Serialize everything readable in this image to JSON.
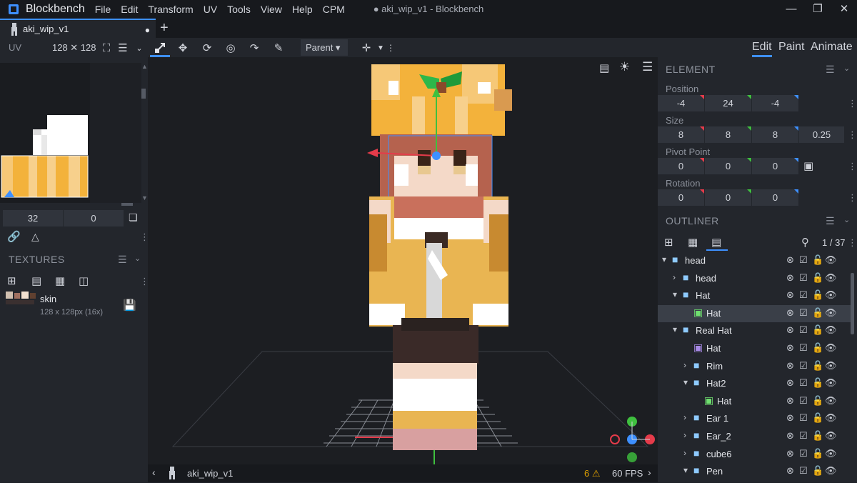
{
  "app": {
    "name": "Blockbench",
    "window_title": "● aki_wip_v1 - Blockbench",
    "menu": [
      "File",
      "Edit",
      "Transform",
      "UV",
      "Tools",
      "View",
      "Help",
      "CPM"
    ]
  },
  "tab": {
    "label": "aki_wip_v1",
    "modified": "●",
    "add": "+"
  },
  "toolbar": {
    "uv_label": "UV",
    "uv_size": "128 ✕ 128",
    "parent_label": "Parent ▾",
    "modes": [
      "Edit",
      "Paint",
      "Animate"
    ]
  },
  "uv_panel": {
    "offset_x": "32",
    "offset_y": "0"
  },
  "textures": {
    "title": "TEXTURES",
    "item": {
      "name": "skin",
      "info": "128 x 128px (16x)"
    }
  },
  "element": {
    "title": "ELEMENT",
    "position_label": "Position",
    "position": [
      "-4",
      "24",
      "-4"
    ],
    "size_label": "Size",
    "size": [
      "8",
      "8",
      "8",
      "0.25"
    ],
    "pivot_label": "Pivot Point",
    "pivot": [
      "0",
      "0",
      "0"
    ],
    "rotation_label": "Rotation",
    "rotation": [
      "0",
      "0",
      "0"
    ]
  },
  "outliner": {
    "title": "OUTLINER",
    "count": "1 / 37",
    "rows": [
      {
        "label": "head",
        "type": "folder",
        "toggle": "▾"
      },
      {
        "label": "head",
        "type": "folder",
        "toggle": "›"
      },
      {
        "label": "Hat",
        "type": "folder",
        "toggle": "▾"
      },
      {
        "label": "Hat",
        "type": "cube-green",
        "toggle": ""
      },
      {
        "label": "Real Hat",
        "type": "folder",
        "toggle": "▾"
      },
      {
        "label": "Hat",
        "type": "cube-purple",
        "toggle": ""
      },
      {
        "label": "Rim",
        "type": "folder",
        "toggle": "›"
      },
      {
        "label": "Hat2",
        "type": "folder",
        "toggle": "▾"
      },
      {
        "label": "Hat",
        "type": "cube-green",
        "toggle": ""
      },
      {
        "label": "Ear 1",
        "type": "folder",
        "toggle": "›"
      },
      {
        "label": "Ear_2",
        "type": "folder",
        "toggle": "›"
      },
      {
        "label": "cube6",
        "type": "folder",
        "toggle": "›"
      },
      {
        "label": "Pen",
        "type": "folder",
        "toggle": "▾"
      }
    ]
  },
  "status": {
    "file": "aki_wip_v1",
    "warnings": "6",
    "fps": "60 FPS"
  },
  "colors": {
    "accent": "#3e90ff",
    "x_axis": "#e53b4a",
    "y_axis": "#3fc03f",
    "z_axis": "#3e90ff"
  }
}
